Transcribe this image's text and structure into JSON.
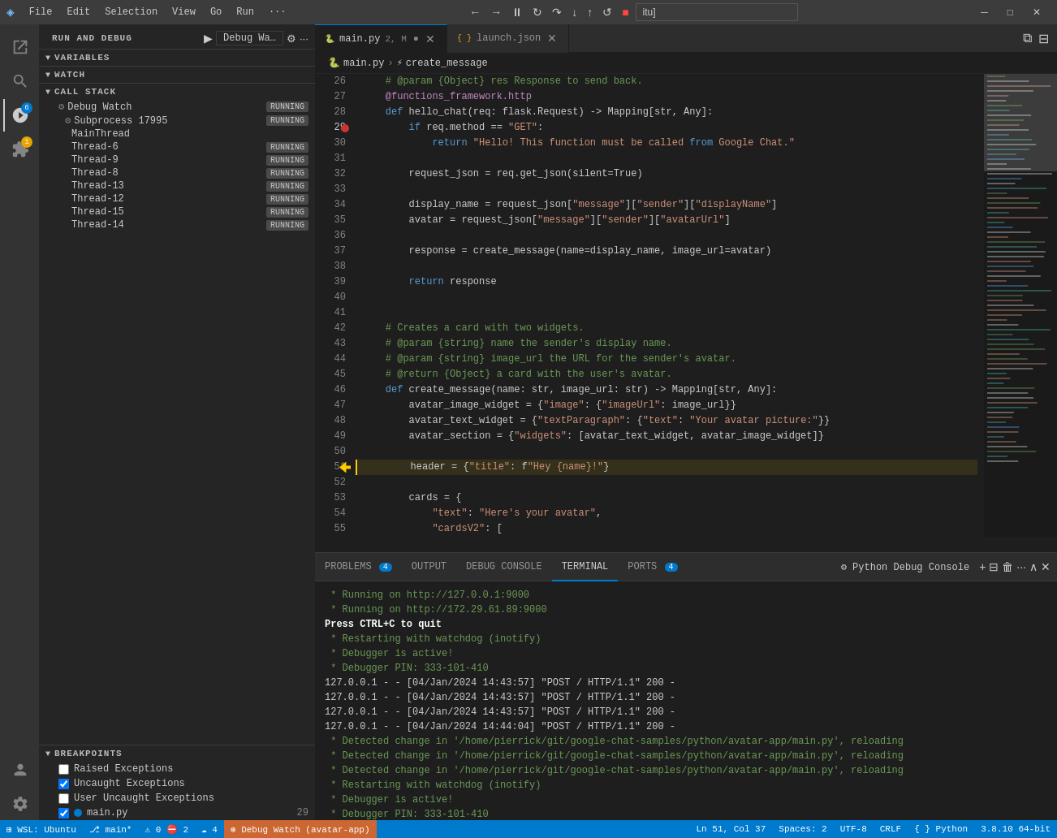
{
  "menubar": {
    "app_icon": "◈",
    "items": [
      "File",
      "Edit",
      "Selection",
      "View",
      "Go",
      "Run",
      "···"
    ],
    "debug_input_value": "itu]",
    "window_controls": [
      "─",
      "□",
      "✕"
    ]
  },
  "sidebar": {
    "title": "RUN AND DEBUG",
    "debug_config": "Debug Wa…",
    "sections": {
      "variables": {
        "label": "VARIABLES"
      },
      "watch": {
        "label": "WATCH"
      },
      "callstack": {
        "label": "CALL STACK",
        "items": [
          {
            "level": 1,
            "icon": "⚙",
            "label": "Debug Watch",
            "badge": "RUNNING"
          },
          {
            "level": 2,
            "icon": "⚙",
            "label": "Subprocess 17995",
            "badge": "RUNNING"
          },
          {
            "level": 3,
            "label": "MainThread",
            "badge": ""
          },
          {
            "level": 3,
            "label": "Thread-6",
            "badge": "RUNNING"
          },
          {
            "level": 3,
            "label": "Thread-9",
            "badge": "RUNNING"
          },
          {
            "level": 3,
            "label": "Thread-8",
            "badge": "RUNNING"
          },
          {
            "level": 3,
            "label": "Thread-13",
            "badge": "RUNNING"
          },
          {
            "level": 3,
            "label": "Thread-12",
            "badge": "RUNNING"
          },
          {
            "level": 3,
            "label": "Thread-15",
            "badge": "RUNNING"
          },
          {
            "level": 3,
            "label": "Thread-14",
            "badge": "RUNNING"
          }
        ]
      },
      "breakpoints": {
        "label": "BREAKPOINTS",
        "items": [
          {
            "type": "checkbox",
            "checked": false,
            "label": "Raised Exceptions"
          },
          {
            "type": "checkbox",
            "checked": true,
            "label": "Uncaught Exceptions"
          },
          {
            "type": "checkbox",
            "checked": false,
            "label": "User Uncaught Exceptions"
          },
          {
            "type": "file",
            "checked": true,
            "dot": true,
            "label": "main.py",
            "count": "29"
          }
        ]
      }
    }
  },
  "editor": {
    "tabs": [
      {
        "label": "main.py",
        "detail": "2, M",
        "active": true,
        "modified": true
      },
      {
        "label": "launch.json",
        "active": false,
        "modified": false
      }
    ],
    "breadcrumb": [
      "main.py",
      "create_message"
    ],
    "lines": [
      {
        "num": 26,
        "code": "    # @param {Object} res Response to send back."
      },
      {
        "num": 27,
        "code": "    @functions_framework.http"
      },
      {
        "num": 28,
        "code": "    def hello_chat(req: flask.Request) -> Mapping[str, Any]:"
      },
      {
        "num": 29,
        "code": "        if req.method == \"GET\":",
        "breakpoint": true
      },
      {
        "num": 30,
        "code": "            return \"Hello! This function must be called from Google Chat.\""
      },
      {
        "num": 31,
        "code": ""
      },
      {
        "num": 32,
        "code": "        request_json = req.get_json(silent=True)"
      },
      {
        "num": 33,
        "code": ""
      },
      {
        "num": 34,
        "code": "        display_name = request_json[\"message\"][\"sender\"][\"displayName\"]"
      },
      {
        "num": 35,
        "code": "        avatar = request_json[\"message\"][\"sender\"][\"avatarUrl\"]"
      },
      {
        "num": 36,
        "code": ""
      },
      {
        "num": 37,
        "code": "        response = create_message(name=display_name, image_url=avatar)"
      },
      {
        "num": 38,
        "code": ""
      },
      {
        "num": 39,
        "code": "        return response"
      },
      {
        "num": 40,
        "code": ""
      },
      {
        "num": 41,
        "code": ""
      },
      {
        "num": 42,
        "code": "    # Creates a card with two widgets."
      },
      {
        "num": 43,
        "code": "    # @param {string} name the sender's display name."
      },
      {
        "num": 44,
        "code": "    # @param {string} image_url the URL for the sender's avatar."
      },
      {
        "num": 45,
        "code": "    # @return {Object} a card with the user's avatar."
      },
      {
        "num": 46,
        "code": "    def create_message(name: str, image_url: str) -> Mapping[str, Any]:"
      },
      {
        "num": 47,
        "code": "        avatar_image_widget = {\"image\": {\"imageUrl\": image_url}}"
      },
      {
        "num": 48,
        "code": "        avatar_text_widget = {\"textParagraph\": {\"text\": \"Your avatar picture:\"}}"
      },
      {
        "num": 49,
        "code": "        avatar_section = {\"widgets\": [avatar_text_widget, avatar_image_widget]}"
      },
      {
        "num": 50,
        "code": ""
      },
      {
        "num": 51,
        "code": "        header = {\"title\": f\"Hey {name}!\"}",
        "debug": true
      },
      {
        "num": 52,
        "code": ""
      },
      {
        "num": 53,
        "code": "        cards = {"
      },
      {
        "num": 54,
        "code": "            \"text\": \"Here's your avatar\","
      },
      {
        "num": 55,
        "code": "            \"cardsV2\": ["
      }
    ]
  },
  "panel": {
    "tabs": [
      {
        "label": "PROBLEMS",
        "badge": "4",
        "active": false
      },
      {
        "label": "OUTPUT",
        "badge": "",
        "active": false
      },
      {
        "label": "DEBUG CONSOLE",
        "badge": "",
        "active": false
      },
      {
        "label": "TERMINAL",
        "badge": "",
        "active": true
      },
      {
        "label": "PORTS",
        "badge": "4",
        "active": false
      }
    ],
    "console_label": "Python Debug Console",
    "terminal_lines": [
      {
        "text": " * Running on http://127.0.0.1:9000"
      },
      {
        "text": " * Running on http://172.29.61.89:9000"
      },
      {
        "text": "Press CTRL+C to quit",
        "bold": true
      },
      {
        "text": " * Restarting with watchdog (inotify)"
      },
      {
        "text": " * Debugger is active!"
      },
      {
        "text": " * Debugger PIN: 333-101-410"
      },
      {
        "text": "127.0.0.1 - - [04/Jan/2024 14:43:57] \"POST / HTTP/1.1\" 200 -"
      },
      {
        "text": "127.0.0.1 - - [04/Jan/2024 14:43:57] \"POST / HTTP/1.1\" 200 -"
      },
      {
        "text": "127.0.0.1 - - [04/Jan/2024 14:43:57] \"POST / HTTP/1.1\" 200 -"
      },
      {
        "text": "127.0.0.1 - - [04/Jan/2024 14:44:04] \"POST / HTTP/1.1\" 200 -"
      },
      {
        "text": " * Detected change in '/home/pierrick/git/google-chat-samples/python/avatar-app/main.py', reloading"
      },
      {
        "text": " * Detected change in '/home/pierrick/git/google-chat-samples/python/avatar-app/main.py', reloading"
      },
      {
        "text": " * Detected change in '/home/pierrick/git/google-chat-samples/python/avatar-app/main.py', reloading"
      },
      {
        "text": " * Restarting with watchdog (inotify)"
      },
      {
        "text": " * Debugger is active!"
      },
      {
        "text": " * Debugger PIN: 333-101-410"
      },
      {
        "text": "▌",
        "cursor": true
      }
    ]
  },
  "statusbar": {
    "left": [
      {
        "label": "⊞ WSL: Ubuntu",
        "icon": true
      },
      {
        "label": "⎇ main*"
      },
      {
        "label": "⚠ 0 ⛔ 2"
      },
      {
        "label": "☁ 4"
      }
    ],
    "debug": "⊛ Debug Watch (avatar-app)",
    "right": [
      {
        "label": "Ln 51, Col 37"
      },
      {
        "label": "Spaces: 2"
      },
      {
        "label": "UTF-8"
      },
      {
        "label": "CRLF"
      },
      {
        "label": "{ } Python"
      },
      {
        "label": "3.8.10 64-bit"
      }
    ]
  }
}
